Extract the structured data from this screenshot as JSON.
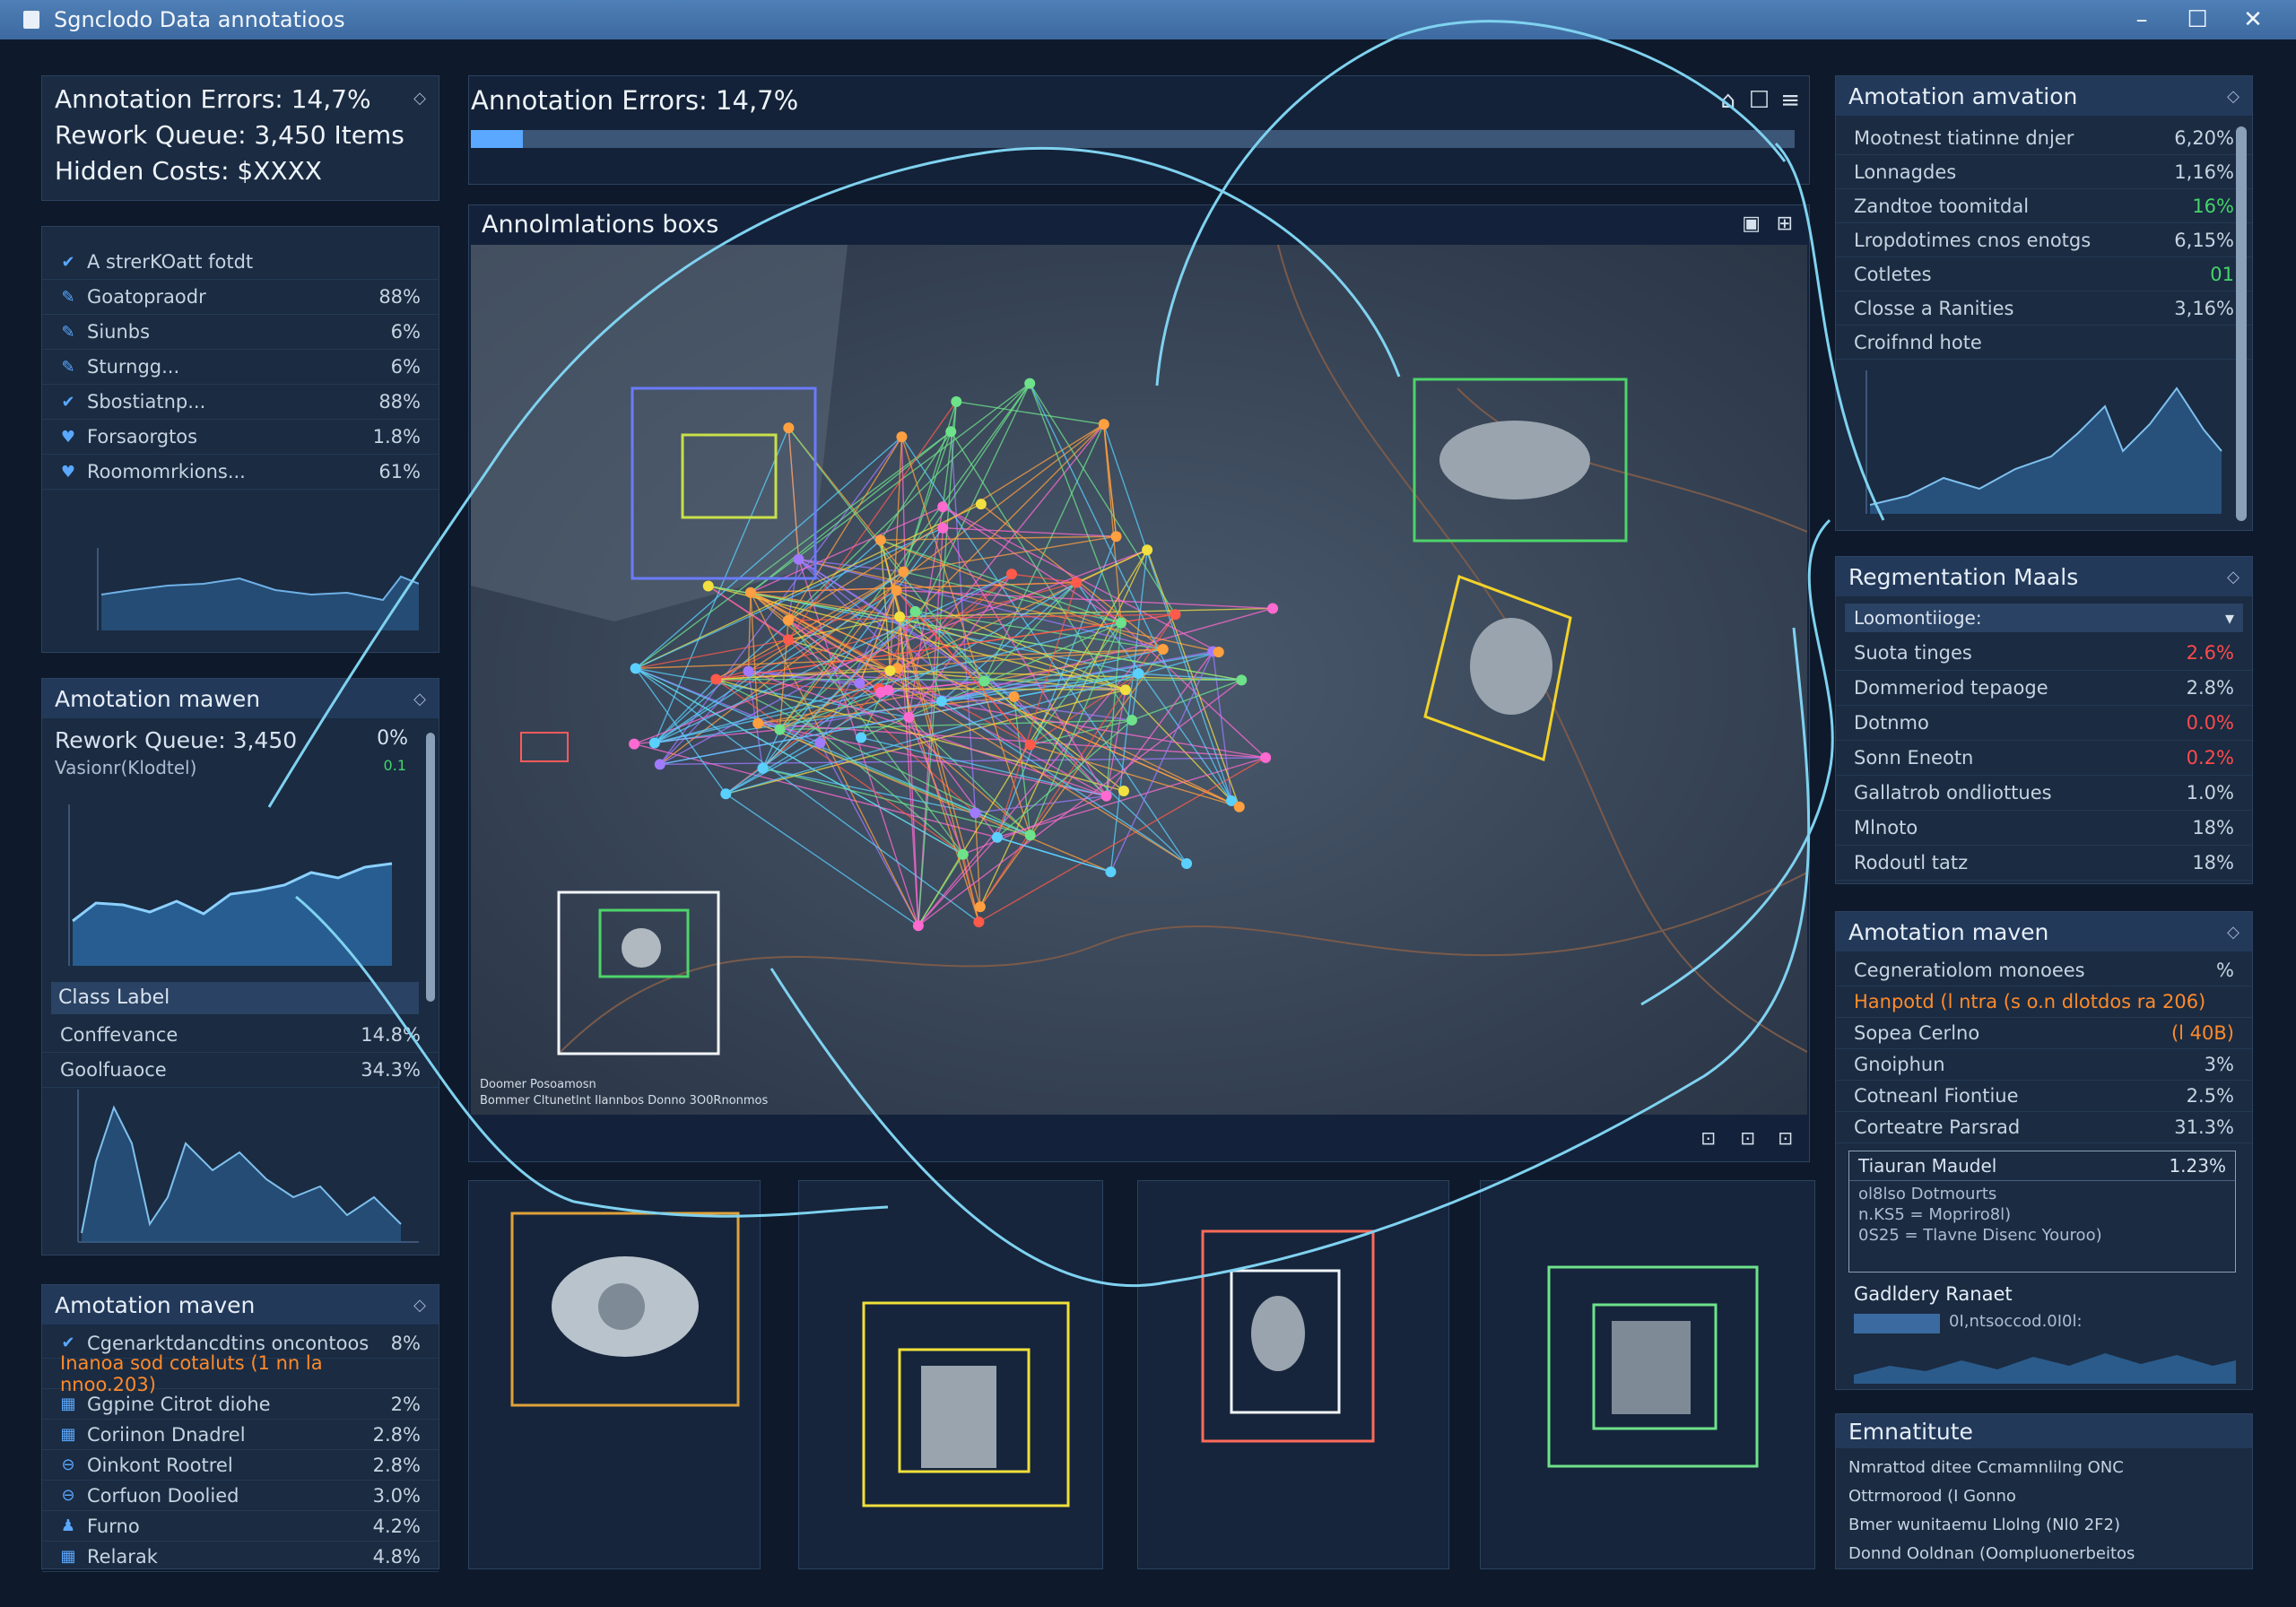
{
  "window": {
    "title": "Sgnclodo Data annotatioos",
    "minimize": "–",
    "maximize": "☐",
    "close": "✕"
  },
  "top_stats": {
    "errors": "Annotation Errors: 14,7%",
    "rework": "Rework Queue: 3,450 Items",
    "costs": "Hidden Costs: $XXXX"
  },
  "left_list": {
    "items": [
      {
        "label": "A strerKOatt fotdt",
        "value": "",
        "icon": "check-icon"
      },
      {
        "label": "Goatopraodr",
        "value": "88%",
        "icon": "pencil-icon"
      },
      {
        "label": "Siunbs",
        "value": "6%",
        "icon": "pencil-icon"
      },
      {
        "label": "Sturngg...",
        "value": "6%",
        "icon": "pencil-icon"
      },
      {
        "label": "Sbostiatnp...",
        "value": "88%",
        "icon": "check-icon"
      },
      {
        "label": "Forsaorgtos",
        "value": "1.8%",
        "icon": "heart-icon"
      },
      {
        "label": "Roomomrkions...",
        "value": "61%",
        "icon": "heart-icon"
      }
    ]
  },
  "left_mid": {
    "title": "Amotation mawen",
    "rework": "Rework Queue: 3,450",
    "rework_pct": "0%",
    "sub": "Vasionr(Klodtel)",
    "sub_val": "0.1",
    "class_label": "Class Label",
    "rows": [
      {
        "label": "Conffevance",
        "value": "14.8%"
      },
      {
        "label": "Goolfuaoce",
        "value": "34.3%"
      }
    ]
  },
  "left_bottom": {
    "title": "Amotation maven",
    "rows": [
      {
        "label": "Cgenarktdancdtins oncontoos",
        "value": "8%",
        "icon": "check-icon"
      },
      {
        "label": "Inanoa sod cotaluts (1 nn la nnoo.203)",
        "value": "",
        "icon": ""
      },
      {
        "label": "Ggpine Citrot diohe",
        "value": "2%",
        "icon": "grid-icon"
      },
      {
        "label": "Coriinon Dnadrel",
        "value": "2.8%",
        "icon": "grid-icon"
      },
      {
        "label": "Oinkont Rootrel",
        "value": "2.8%",
        "icon": "minus-icon"
      },
      {
        "label": "Corfuon Doolied",
        "value": "3.0%",
        "icon": "minus-icon"
      },
      {
        "label": "Furno",
        "value": "4.2%",
        "icon": "person-icon"
      },
      {
        "label": "Relarak",
        "value": "4.8%",
        "icon": "grid-icon"
      }
    ]
  },
  "center": {
    "header": "Annotation Errors: 14,7%",
    "map_title": "Annolmlations boxs",
    "caption1": "Doomer Posoamosn",
    "caption2": "Bommer Cltunetlnt Ilannbos Donno 3O0Rnonmos"
  },
  "right_top": {
    "title": "Amotation amvation",
    "rows": [
      {
        "label": "Mootnest tiatinne dnjer",
        "value": "6,20%"
      },
      {
        "label": "Lonnagdes",
        "value": "1,16%"
      },
      {
        "label": "Zandtoe toomitdal",
        "value": "16%"
      },
      {
        "label": "Lropdotimes cnos enotgs",
        "value": "6,15%"
      },
      {
        "label": "Cotletes",
        "value": "01"
      },
      {
        "label": "Closse a Ranities",
        "value": "3,16%"
      },
      {
        "label": "Croifnnd hote",
        "value": ""
      }
    ]
  },
  "right_seg": {
    "title": "Regmentation Maals",
    "dropdown": "Loomontiioge:",
    "rows": [
      {
        "label": "Suota tinges",
        "value": "2.6%",
        "tone": "red"
      },
      {
        "label": "Dommeriod tepaoge",
        "value": "2.8%",
        "tone": ""
      },
      {
        "label": "Dotnmo",
        "value": "0.0%",
        "tone": "red"
      },
      {
        "label": "Sonn Eneotn",
        "value": "0.2%",
        "tone": "red"
      },
      {
        "label": "Gallatrob ondliottues",
        "value": "1.0%",
        "tone": ""
      },
      {
        "label": "Mlnoto",
        "value": "18%",
        "tone": ""
      },
      {
        "label": "Rodoutl tatz",
        "value": "18%",
        "tone": ""
      }
    ]
  },
  "right_mid": {
    "title": "Amotation maven",
    "rows": [
      {
        "label": "Cegneratiolom monoees",
        "value": "%"
      },
      {
        "label": "Hanpotd (l ntra (s o.n dlotdos ra 206)",
        "value": ""
      },
      {
        "label": "Sopea Cerlno",
        "value": "(l 40B)"
      },
      {
        "label": "Gnoiphun",
        "value": "3%"
      },
      {
        "label": "Cotneanl Fiontiue",
        "value": "2.5%"
      },
      {
        "label": "Corteatre Parsrad",
        "value": "31.3%"
      }
    ],
    "box_title": "Tiauran Maudel",
    "box_val": "1.23%",
    "box_lines": [
      "ol8lso Dotmourts",
      "n.KS5 = Mopriro8l)",
      "0S25 = Tlavne Disenc Youroo)"
    ],
    "grad": "Gadldery Ranaet",
    "grad_sub": "0I,ntsoccod.0I0l:"
  },
  "right_bottom": {
    "title": "Emnatitute",
    "lines": [
      "Nmrattod ditee Ccmamnlilng ONC",
      "Ottrmorood (I Gonno",
      "Bmer wunitaemu Llolng (Nl0 2F2)",
      "Donnd Ooldnan (Oompluonerbeitos"
    ]
  },
  "colors": {
    "bg": "#0e1a2b",
    "panel": "#1a2b42",
    "accent": "#5aa8ff",
    "line": "#7fd2f0"
  }
}
